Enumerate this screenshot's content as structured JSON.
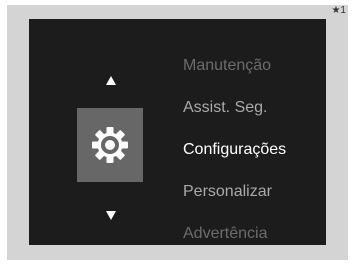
{
  "footnote": "★1",
  "screen": {
    "nav_up_icon": "up-triangle",
    "nav_down_icon": "down-triangle",
    "selected_icon": "gear-icon",
    "menu": [
      {
        "label": "Manutenção"
      },
      {
        "label": "Assist. Seg."
      },
      {
        "label": "Configurações",
        "selected": true
      },
      {
        "label": "Personalizar"
      },
      {
        "label": "Advertência"
      }
    ]
  },
  "colors": {
    "frame": "#d4d4d4",
    "screen_bg": "#1c1c1c",
    "selected_tile": "#676767",
    "selected_text": "#ffffff",
    "dim_text": "#a9a9a9",
    "faded_text": "#6c6c6c"
  }
}
